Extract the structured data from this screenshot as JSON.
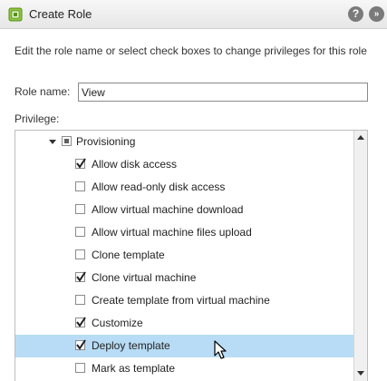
{
  "window": {
    "title": "Create Role",
    "help_symbol": "?",
    "expand_symbol": "»"
  },
  "description": "Edit the role name or select check boxes to change privileges for this role",
  "role_name": {
    "label": "Role name:",
    "value": "View"
  },
  "privilege": {
    "label": "Privilege:",
    "group": {
      "label": "Provisioning",
      "state": "partial",
      "expanded": true
    },
    "items": [
      {
        "label": "Allow disk access",
        "checked": true,
        "selected": false
      },
      {
        "label": "Allow read-only disk access",
        "checked": false,
        "selected": false
      },
      {
        "label": "Allow virtual machine download",
        "checked": false,
        "selected": false
      },
      {
        "label": "Allow virtual machine files upload",
        "checked": false,
        "selected": false
      },
      {
        "label": "Clone template",
        "checked": false,
        "selected": false
      },
      {
        "label": "Clone virtual machine",
        "checked": true,
        "selected": false
      },
      {
        "label": "Create template from virtual machine",
        "checked": false,
        "selected": false
      },
      {
        "label": "Customize",
        "checked": true,
        "selected": false
      },
      {
        "label": "Deploy template",
        "checked": true,
        "selected": true
      },
      {
        "label": "Mark as template",
        "checked": false,
        "selected": false
      }
    ]
  },
  "colors": {
    "selected_row": "#b8dcf5",
    "header_icon": "#7a7a7a",
    "app_icon": "#8dc63f"
  }
}
